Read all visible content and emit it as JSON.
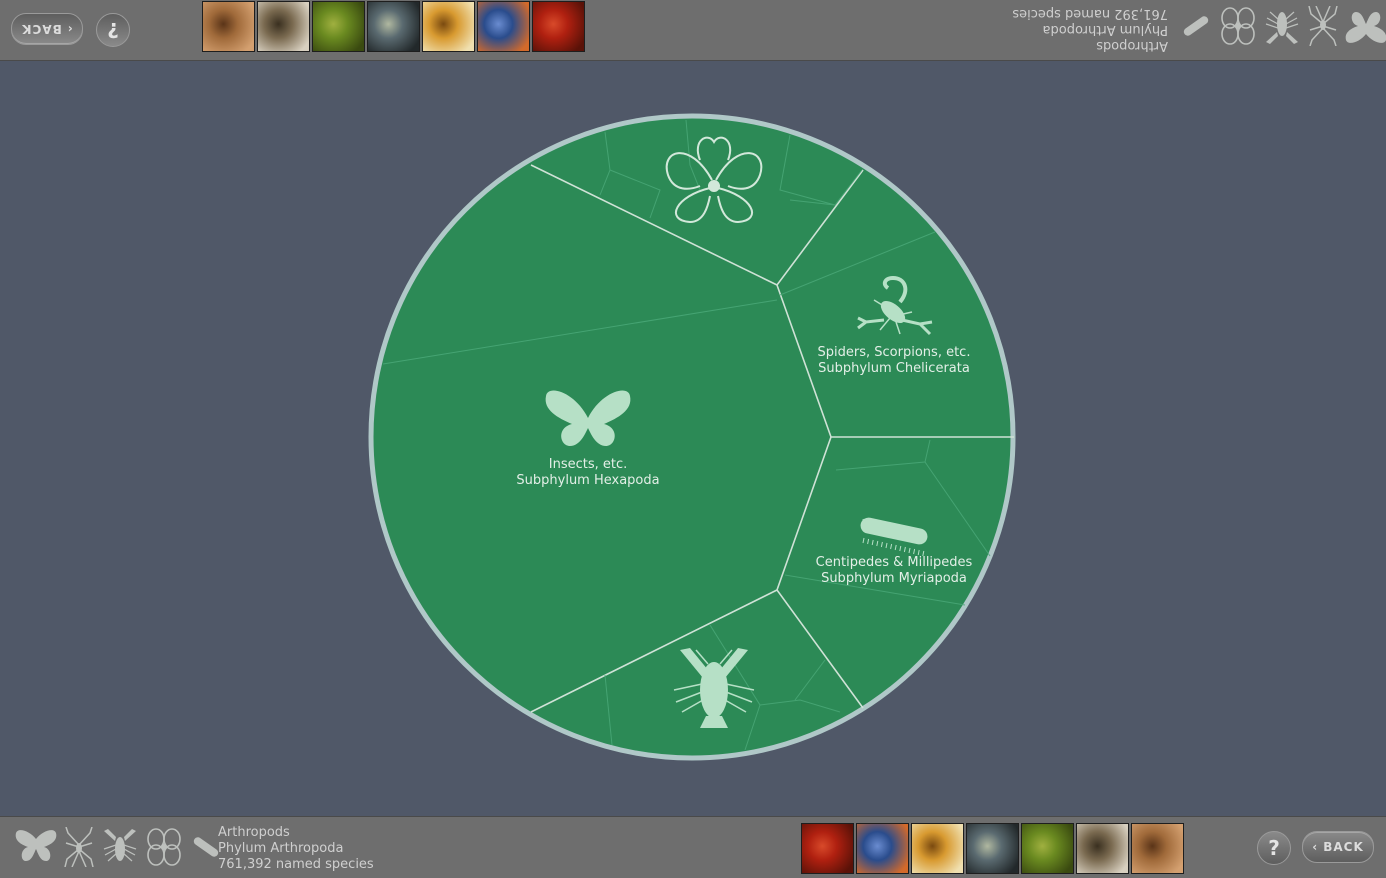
{
  "group": {
    "name": "Arthropods",
    "taxon": "Phylum Arthropoda",
    "species": "761,392 named species"
  },
  "controls": {
    "back_label": "BACK",
    "help_label": "?"
  },
  "thumbnails": [
    {
      "name": "red-mite",
      "colors": [
        "#b02010",
        "#5a1208",
        "#d84a2a"
      ]
    },
    {
      "name": "blue-orange-isopod",
      "colors": [
        "#2a4c8c",
        "#d46a2a",
        "#6a8cd0"
      ]
    },
    {
      "name": "bee",
      "colors": [
        "#d89a30",
        "#f0e0b0",
        "#7a4a10"
      ]
    },
    {
      "name": "shrimp",
      "colors": [
        "#5a6a70",
        "#22282a",
        "#b0b8a0"
      ]
    },
    {
      "name": "green-insect",
      "colors": [
        "#6a8a20",
        "#3a4a10",
        "#a0b040"
      ]
    },
    {
      "name": "stick-bark",
      "colors": [
        "#7a6a50",
        "#d8d0c0",
        "#3a3020"
      ]
    },
    {
      "name": "brown-crab",
      "colors": [
        "#a06a3a",
        "#d4a070",
        "#5a3418"
      ]
    }
  ],
  "wheel": {
    "fill": "#2c8a56",
    "rim": "#b0c8c8",
    "segments": [
      {
        "id": "hexapoda",
        "common": "Insects, etc.",
        "taxon": "Subphylum Hexapoda"
      },
      {
        "id": "chelicerata",
        "common": "Spiders, Scorpions, etc.",
        "taxon": "Subphylum Chelicerata"
      },
      {
        "id": "myriapoda",
        "common": "Centipedes & Millipedes",
        "taxon": "Subphylum Myriapoda"
      },
      {
        "id": "crustacea",
        "common": "",
        "taxon": ""
      },
      {
        "id": "pycnogonida",
        "common": "",
        "taxon": ""
      }
    ]
  },
  "silhouettes": [
    "butterfly-icon",
    "spider-icon",
    "crayfish-icon",
    "sea-spider-icon",
    "millipede-icon"
  ]
}
